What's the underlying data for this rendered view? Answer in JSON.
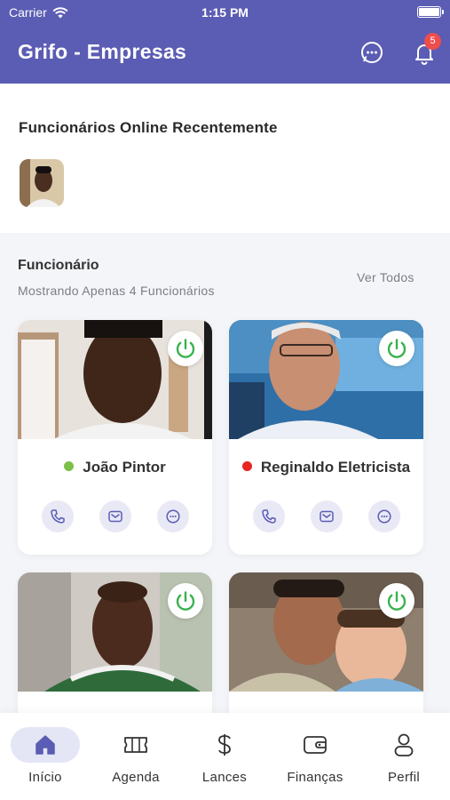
{
  "status_bar": {
    "carrier": "Carrier",
    "time": "1:15 PM"
  },
  "header": {
    "title": "Grifo - Empresas",
    "notification_count": "5",
    "icons": [
      "chat-icon",
      "bell-icon"
    ]
  },
  "recent": {
    "title": "Funcionários Online Recentemente"
  },
  "employees_section": {
    "title": "Funcionário",
    "subtitle": "Mostrando Apenas 4 Funcionários",
    "see_all": "Ver Todos"
  },
  "employees": [
    {
      "name": "João Pintor",
      "status": "online",
      "status_color": "#7cc04a"
    },
    {
      "name": "Reginaldo Eletricista",
      "status": "offline",
      "status_color": "#e8251f"
    },
    {
      "name": "",
      "status": "",
      "status_color": ""
    },
    {
      "name": "",
      "status": "",
      "status_color": ""
    }
  ],
  "colors": {
    "primary": "#5b5cb3",
    "power_green": "#37b24d",
    "action_bg": "#e9e9f6"
  },
  "tabbar": {
    "tabs": [
      {
        "label": "Início",
        "icon": "home-icon",
        "active": true
      },
      {
        "label": "Agenda",
        "icon": "ticket-icon",
        "active": false
      },
      {
        "label": "Lances",
        "icon": "dollar-icon",
        "active": false
      },
      {
        "label": "Finanças",
        "icon": "wallet-icon",
        "active": false
      },
      {
        "label": "Perfil",
        "icon": "user-icon",
        "active": false
      }
    ]
  }
}
